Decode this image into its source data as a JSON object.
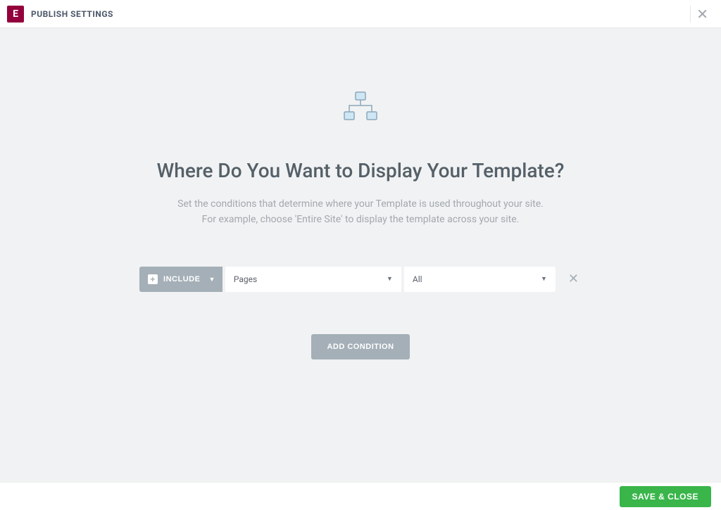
{
  "header": {
    "logo_letter": "E",
    "title": "PUBLISH SETTINGS"
  },
  "main": {
    "title": "Where Do You Want to Display Your Template?",
    "subtitle_line1": "Set the conditions that determine where your Template is used throughout your site.",
    "subtitle_line2": "For example, choose 'Entire Site' to display the template across your site."
  },
  "condition": {
    "type_label": "INCLUDE",
    "dropdown1_value": "Pages",
    "dropdown2_value": "All"
  },
  "buttons": {
    "add_condition": "ADD CONDITION",
    "save_close": "SAVE & CLOSE"
  }
}
